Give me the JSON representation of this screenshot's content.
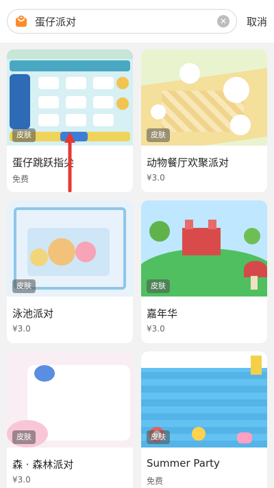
{
  "search": {
    "query": "蛋仔派对",
    "cancel_label": "取消"
  },
  "cards": [
    {
      "title": "蛋仔跳跃指尖",
      "price": "免费",
      "badge": "皮肤"
    },
    {
      "title": "动物餐厅欢聚派对",
      "price": "¥3.0",
      "badge": "皮肤"
    },
    {
      "title": "泳池派对",
      "price": "¥3.0",
      "badge": "皮肤"
    },
    {
      "title": "嘉年华",
      "price": "¥3.0",
      "badge": "皮肤"
    },
    {
      "title": "森 · 森林派对",
      "price": "¥3.0",
      "badge": "皮肤"
    },
    {
      "title": "Summer Party",
      "price": "免费",
      "badge": "皮肤"
    }
  ],
  "icons": {
    "bag": "shopping-bag-icon",
    "clear": "clear-icon"
  },
  "colors": {
    "accent": "#ff8a2b",
    "arrow": "#e53935"
  }
}
